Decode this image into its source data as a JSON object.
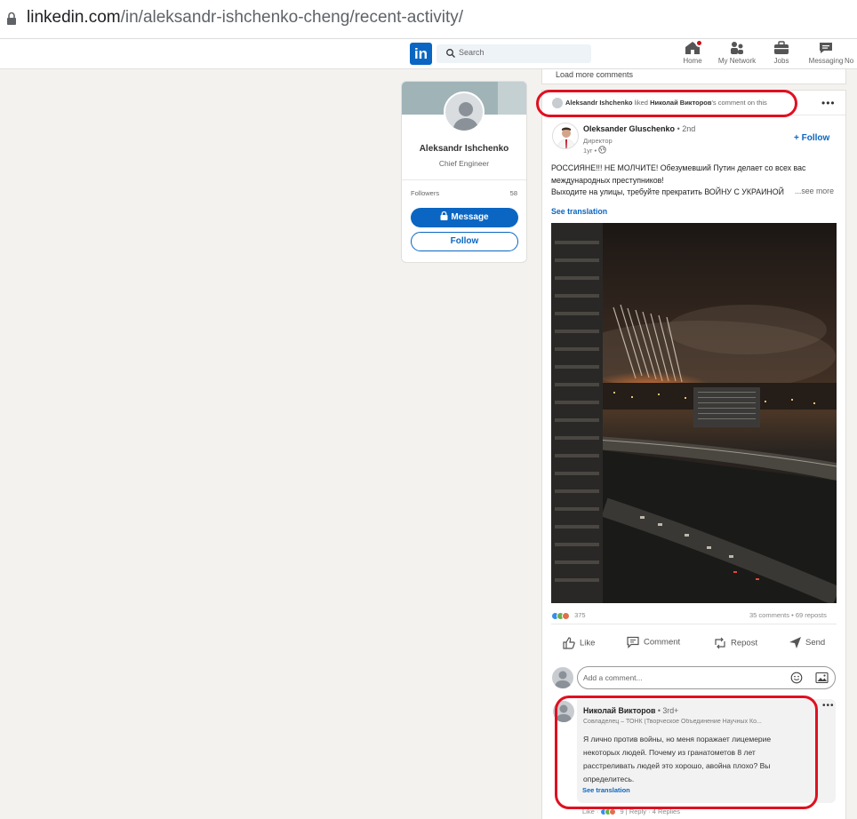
{
  "browser": {
    "url_domain": "linkedin.com",
    "url_path": "/in/aleksandr-ishchenko-cheng/recent-activity/"
  },
  "nav": {
    "logo": "in",
    "search_placeholder": "Search",
    "items": [
      {
        "label": "Home",
        "icon": "home-icon"
      },
      {
        "label": "My Network",
        "icon": "network-icon"
      },
      {
        "label": "Jobs",
        "icon": "briefcase-icon"
      },
      {
        "label": "Messaging",
        "icon": "messaging-icon"
      },
      {
        "label": "No",
        "icon": "notifications-icon"
      }
    ]
  },
  "profile": {
    "name": "Aleksandr Ishchenko",
    "title": "Chief Engineer",
    "followers_label": "Followers",
    "followers_count": "58",
    "message_label": "Message",
    "follow_label": "Follow"
  },
  "feed": {
    "load_more": "Load more comments",
    "activity": {
      "actor": "Aleksandr Ishchenko",
      "verb": "liked",
      "target": "Николай Викторов",
      "suffix": "'s comment on this"
    },
    "post": {
      "author": "Oleksander Gluschenko",
      "degree": "• 2nd",
      "subtitle": "Директор",
      "time": "1yr •",
      "follow_label": "+ Follow",
      "text_lines": [
        "РОССИЯНЕ!!! НЕ МОЛЧИТЕ! Обезумевший Путин делает со всех вас",
        "международных преступников!",
        "Выходите на улицы, требуйте прекратить ВОЙНУ С УКРАИНОЙ"
      ],
      "see_more": "...see more",
      "see_translation": "See translation",
      "reactions_count": "375",
      "comments": "35 comments",
      "reposts": "69 reposts",
      "actions": [
        "Like",
        "Comment",
        "Repost",
        "Send"
      ]
    },
    "comment_input_placeholder": "Add a comment...",
    "comment": {
      "author": "Николай Викторов",
      "degree": "• 3rd+",
      "subtitle": "Совладелец – ТОНК (Творческое Объединение Научных Ко...",
      "text_lines": [
        "Я лично против войны, но меня поражает лицемерие",
        "некоторых людей. Почему из гранатометов 8 лет",
        "расстреливать людей это хорошо, авойна плохо? Вы",
        "определитесь."
      ],
      "see_translation": "See translation",
      "like_label": "Like",
      "reaction_count": "9",
      "reply_label": "Reply",
      "replies": "4 Replies"
    }
  },
  "colors": {
    "linkedin_blue": "#0a66c2",
    "highlight_red": "#e01020",
    "page_bg": "#f3f2ef"
  }
}
